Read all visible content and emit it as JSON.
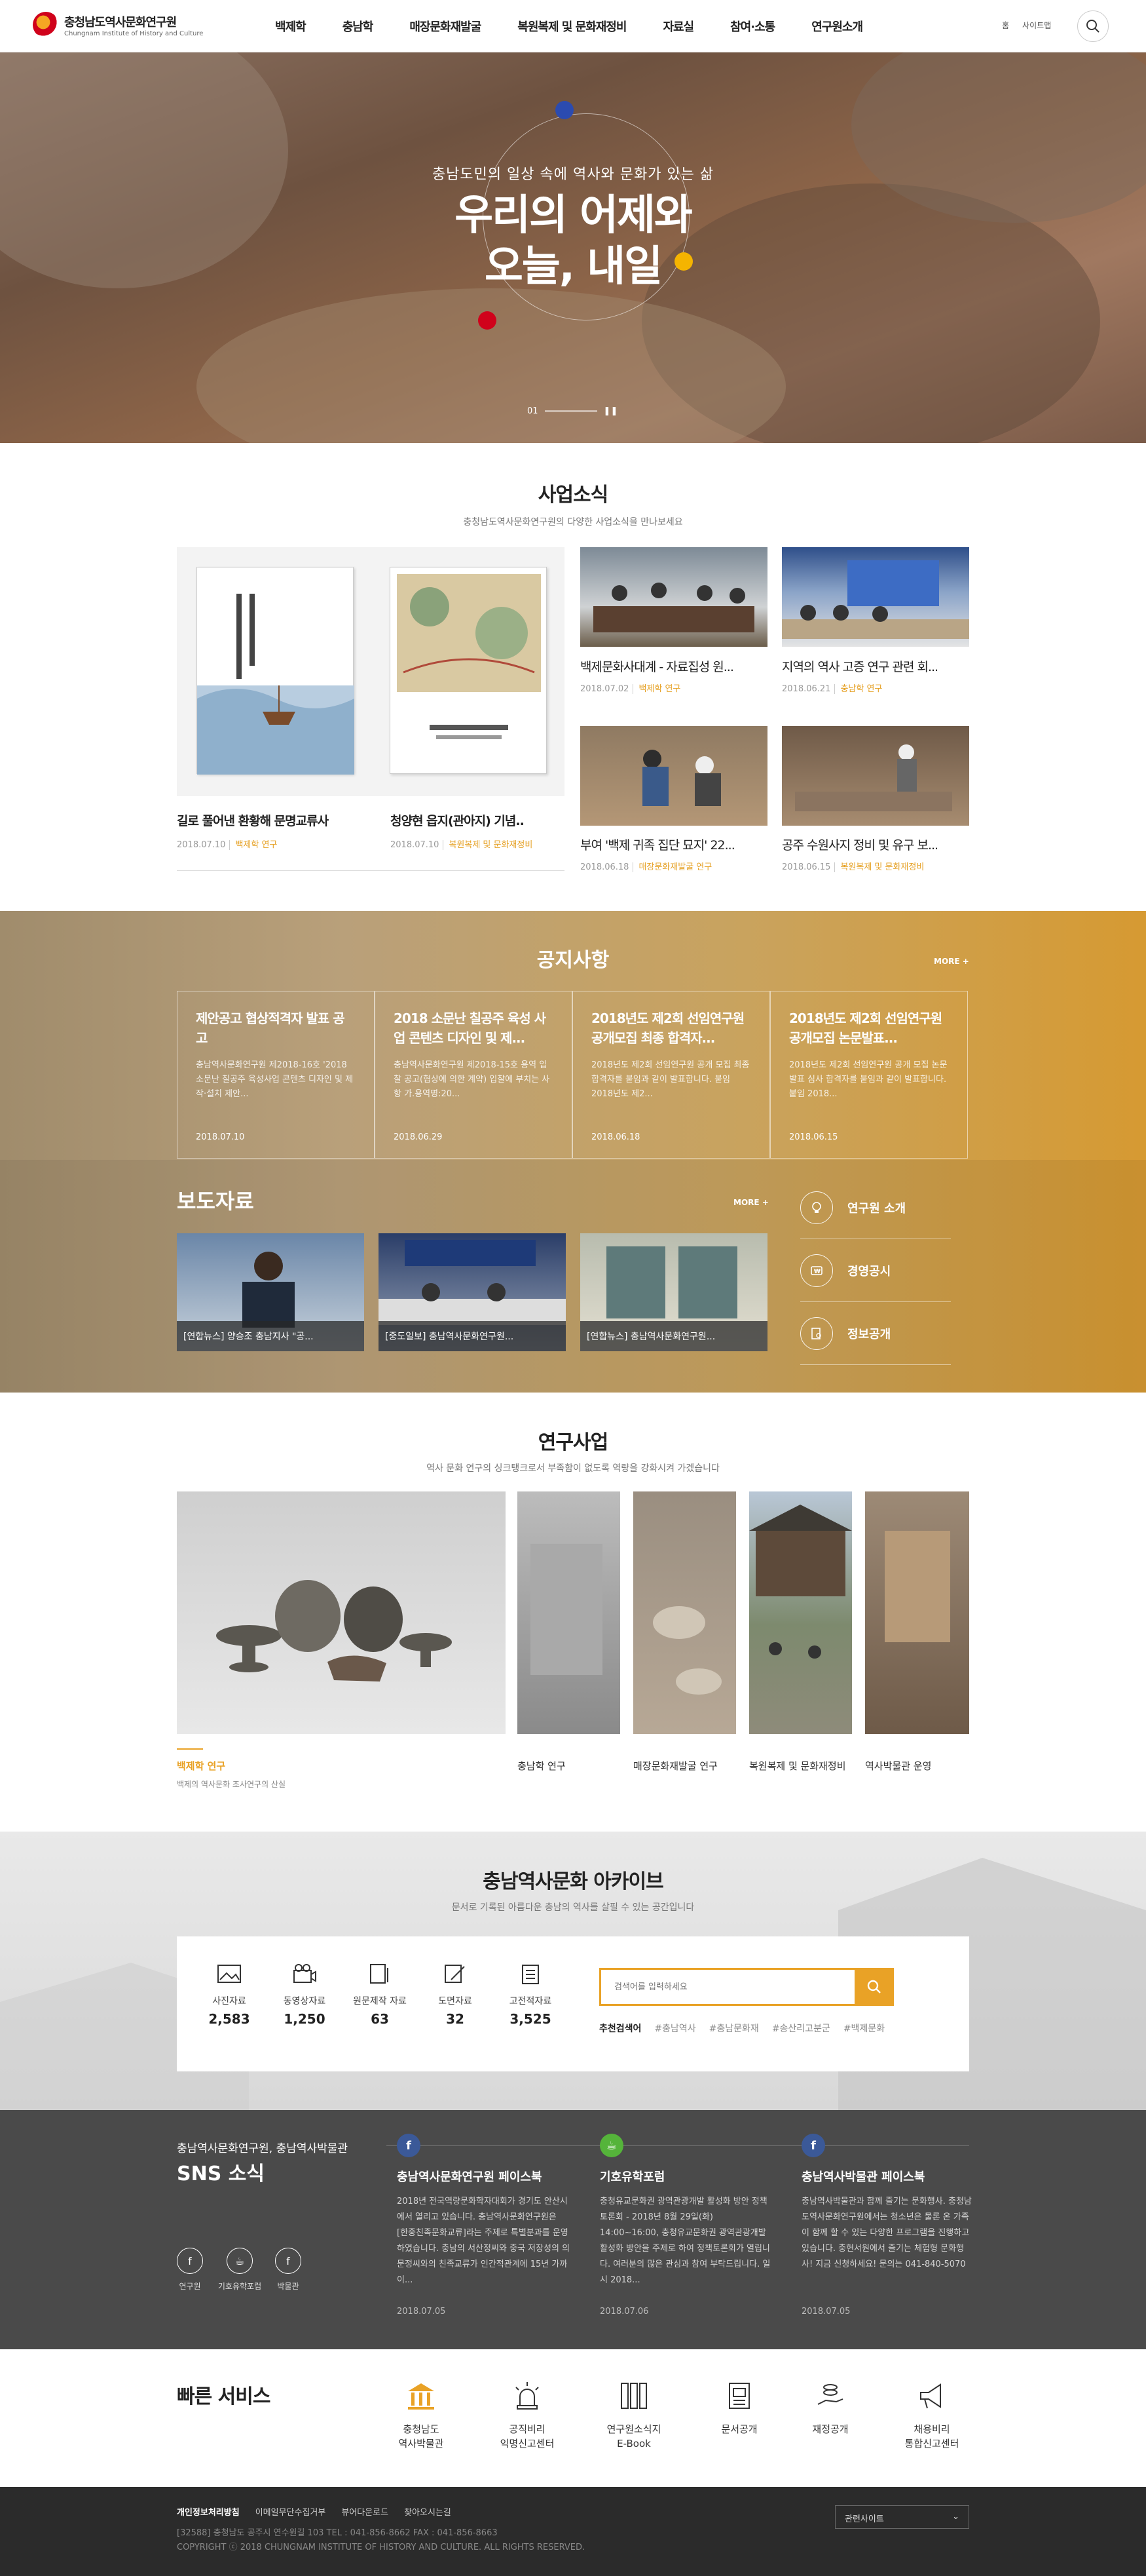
{
  "header": {
    "logo_kr": "충청남도역사문화연구원",
    "logo_en": "Chungnam Institute of History and Culture",
    "nav": [
      "백제학",
      "충남학",
      "매장문화재발굴",
      "복원복제 및 문화재정비",
      "자료실",
      "참여·소통",
      "연구원소개"
    ],
    "util": [
      "홈",
      "사이트맵"
    ]
  },
  "hero": {
    "subtitle": "충남도민의 일상 속에 역사와 문화가 있는 삶",
    "title_line1": "우리의 어제와",
    "title_line2": "오늘, 내일",
    "counter": "01",
    "pause": "❚❚"
  },
  "news": {
    "title": "사업소식",
    "subtitle": "충청남도역사문화연구원의 다양한 사업소식을 만나보세요",
    "books": [
      {
        "caption": "길로 풀어낸 환황해 문명교류사",
        "date": "2018.07.10",
        "category": "백제학 연구"
      },
      {
        "caption": "청양현 읍지(관아지) 기념..",
        "date": "2018.07.10",
        "category": "복원복제 및 문화재정비"
      }
    ],
    "items": [
      {
        "caption": "백제문화사대계 - 자료집성 원...",
        "date": "2018.07.02",
        "category": "백제학 연구"
      },
      {
        "caption": "지역의 역사 고증 연구 관련 회...",
        "date": "2018.06.21",
        "category": "충남학 연구"
      },
      {
        "caption": "부여 '백제 귀족 집단 묘지' 22...",
        "date": "2018.06.18",
        "category": "매장문화재발굴 연구"
      },
      {
        "caption": "공주 수원사지 정비 및 유구 보...",
        "date": "2018.06.15",
        "category": "복원복제 및 문화재정비"
      }
    ]
  },
  "notice": {
    "title": "공지사항",
    "more": "MORE +",
    "items": [
      {
        "title": "제안공고 협상적격자 발표 공고",
        "body": "충남역사문화연구원 제2018-16호 '2018 소문난 칠공주 육성사업 콘텐츠 디자인 및 제작·설치 제안...",
        "date": "2018.07.10"
      },
      {
        "title": "2018 소문난 칠공주 육성 사업 콘텐츠 디자인 및 제...",
        "body": "충남역사문화연구원 제2018-15호 용역 입찰 공고(협상에 의한 계약) 입찰에 부치는 사항 가.용역명:20...",
        "date": "2018.06.29"
      },
      {
        "title": "2018년도 제2회 선임연구원 공개모집 최종 합격자...",
        "body": "2018년도 제2회 선임연구원 공개 모집 최종 합격자를 붙임과 같이 발표합니다. 붙임 2018년도 제2...",
        "date": "2018.06.18"
      },
      {
        "title": "2018년도 제2회 선임연구원 공개모집 논문발표...",
        "body": "2018년도 제2회 선임연구원 공개 모집 논문발표 심사 합격자를 붙임과 같이 발표합니다. 붙임 2018...",
        "date": "2018.06.15"
      }
    ]
  },
  "press": {
    "title": "보도자료",
    "more": "MORE +",
    "items": [
      "[연합뉴스] 양승조 충남지사 \"공...",
      "[중도일보] 충남역사문화연구원...",
      "[연합뉴스] 충남역사문화연구원..."
    ]
  },
  "quick_links": [
    "연구원 소개",
    "경영공시",
    "정보공개"
  ],
  "research": {
    "title": "연구사업",
    "subtitle": "역사 문화 연구의 싱크탱크로서 부족함이 없도록 역량을 강화시켜 가겠습니다",
    "tiles": [
      "백제학 연구",
      "충남학 연구",
      "매장문화재발굴 연구",
      "복원복제 및 문화재정비",
      "역사박물관 운영"
    ],
    "featured_desc": "백제의 역사문화 조사연구의 산실"
  },
  "archive": {
    "title": "충남역사문화 아카이브",
    "subtitle": "문서로 기록된 아름다운 충남의 역사를 살필 수 있는 공간입니다",
    "stats": [
      {
        "label": "사진자료",
        "value": "2,583"
      },
      {
        "label": "동영상자료",
        "value": "1,250"
      },
      {
        "label": "원문제작 자료",
        "value": "63"
      },
      {
        "label": "도면자료",
        "value": "32"
      },
      {
        "label": "고전적자료",
        "value": "3,525"
      }
    ],
    "search_placeholder": "검색어를 입력하세요",
    "tags_label": "추천검색어",
    "tags": [
      "#충남역사",
      "#충남문화재",
      "#송산리고분군",
      "#백제문화"
    ]
  },
  "sns": {
    "heading_small": "충남역사문화연구원, 충남역사박물관",
    "heading": "SNS 소식",
    "icon_labels": [
      "연구원",
      "기호유학포럼",
      "박물관"
    ],
    "posts": [
      {
        "title": "충남역사문화연구원 페이스북",
        "body": "2018년 전국역량문화학자대회가 경기도 안산시에서 열리고 있습니다. 충남역사문화연구원은 [한중친족문화교류]라는 주제로 특별분과를 운영하였습니다. 충남의 서산정씨와 중국 저장성의 의문정씨와의 친족교류가 인간적관계에 15년 가까이...",
        "date": "2018.07.05"
      },
      {
        "title": "기호유학포럼",
        "body": "충청유교문화권 광역관광개발 활성화 방안 정책토론회 - 2018년 8월 29일(화) 14:00~16:00, 충청유교문화권 광역관광개발 활성화 방안을 주제로 하여 정책토론회가 열립니다. 여러분의 많은 관심과 참여 부탁드립니다. 일시 2018...",
        "date": "2018.07.06"
      },
      {
        "title": "충남역사박물관 페이스북",
        "body": "충남역사박물관과 함께 즐기는 문화행사. 충청남도역사문화연구원에서는 청소년은 물론 온 가족이 함께 할 수 있는 다양한 프로그램을 진행하고 있습니다. 충현서원에서 즐기는 체험형 문화행사! 지금 신청하세요! 문의는 041-840-5070",
        "date": "2018.07.05"
      }
    ]
  },
  "quick_service": {
    "title": "빠른 서비스",
    "items": [
      {
        "line1": "충청남도",
        "line2": "역사박물관"
      },
      {
        "line1": "공직비리",
        "line2": "익명신고센터"
      },
      {
        "line1": "연구원소식지",
        "line2": "E-Book"
      },
      {
        "line1": "문서공개",
        "line2": ""
      },
      {
        "line1": "재정공개",
        "line2": ""
      },
      {
        "line1": "채용비리",
        "line2": "통합신고센터"
      }
    ]
  },
  "footer": {
    "links": [
      "개인정보처리방침",
      "이메일무단수집거부",
      "뷰어다운로드",
      "찾아오시는길"
    ],
    "address": "[32588] 충청남도 공주시 연수원길 103    TEL : 041-856-8662    FAX : 041-856-8663",
    "copyright": "COPYRIGHT ⓒ 2018 CHUNGNAM INSTITUTE OF HISTORY AND CULTURE. ALL RIGHTS RESERVED.",
    "related_site": "관련사이트"
  },
  "colors": {
    "accent": "#e9a226",
    "hero_red": "#d0021b",
    "hero_blue": "#2b4bb0",
    "hero_yellow": "#f5b400"
  }
}
